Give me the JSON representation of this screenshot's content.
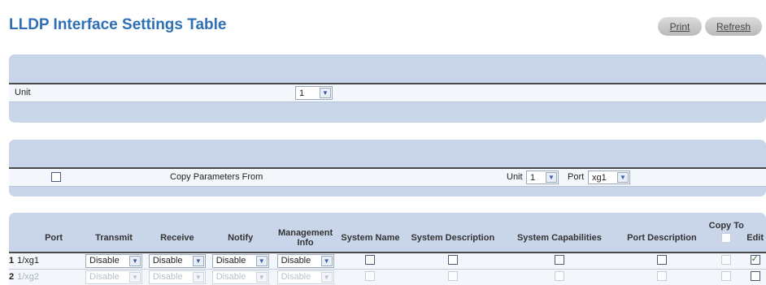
{
  "page": {
    "title": "LLDP Interface Settings Table",
    "print_label": "Print",
    "refresh_label": "Refresh"
  },
  "unit_panel": {
    "label": "Unit",
    "value": "1"
  },
  "copy_panel": {
    "label": "Copy Parameters From",
    "unit_label": "Unit",
    "unit_value": "1",
    "port_label": "Port",
    "port_value": "xg1"
  },
  "table": {
    "headers": {
      "port": "Port",
      "transmit": "Transmit",
      "receive": "Receive",
      "notify": "Notify",
      "management_info": "Management Info",
      "system_name": "System Name",
      "system_description": "System Description",
      "system_capabilities": "System Capabilities",
      "port_description": "Port Description",
      "copy_to": "Copy To",
      "edit": "Edit"
    },
    "rows": [
      {
        "index": "1",
        "port": "1/xg1",
        "transmit": "Disable",
        "receive": "Disable",
        "notify": "Disable",
        "management_info": "Disable",
        "system_name": false,
        "system_description": false,
        "system_capabilities": false,
        "port_description": false,
        "copy_to": false,
        "edit": true
      },
      {
        "index": "2",
        "port": "1/xg2",
        "transmit": "Disable",
        "receive": "Disable",
        "notify": "Disable",
        "management_info": "Disable",
        "system_name": false,
        "system_description": false,
        "system_capabilities": false,
        "port_description": false,
        "copy_to": false,
        "edit": false
      }
    ]
  },
  "colors": {
    "title": "#2f6fb5",
    "panel": "#c9d6ea",
    "row": "#f3f6fb"
  }
}
